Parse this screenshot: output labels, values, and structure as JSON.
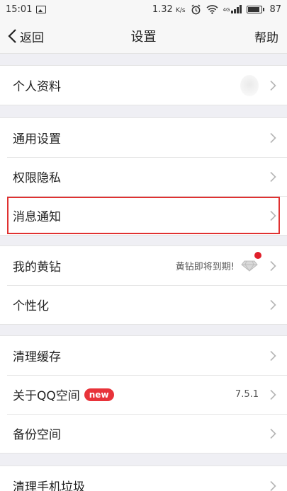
{
  "status_bar": {
    "time": "15:01",
    "speed": "1.32",
    "speed_unit": "K/s",
    "network": "4G",
    "battery": "87"
  },
  "nav": {
    "back_label": "返回",
    "title": "设置",
    "help_label": "帮助"
  },
  "groups": {
    "profile": {
      "label": "个人资料"
    },
    "general": {
      "label": "通用设置"
    },
    "privacy": {
      "label": "权限隐私"
    },
    "notifications": {
      "label": "消息通知"
    },
    "yellow_diamond": {
      "label": "我的黄钻",
      "hint": "黄钻即将到期!"
    },
    "personalize": {
      "label": "个性化"
    },
    "clear_cache": {
      "label": "清理缓存"
    },
    "about": {
      "label": "关于QQ空间",
      "badge": "new",
      "version": "7.5.1"
    },
    "backup": {
      "label": "备份空间"
    },
    "clean_junk": {
      "label": "清理手机垃圾"
    }
  },
  "colors": {
    "highlight": "#e03131",
    "badge": "#e8333a",
    "dot": "#e0202b",
    "background": "#efeff4"
  }
}
